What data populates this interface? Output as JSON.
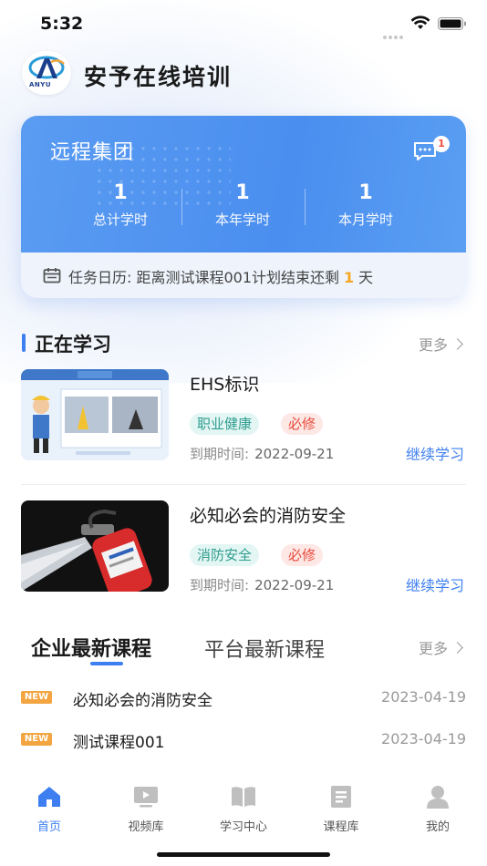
{
  "status_bar": {
    "time": "5:32"
  },
  "header": {
    "logo_text": "ANYU",
    "app_title": "安予在线培训"
  },
  "stats_card": {
    "company": "远程集团",
    "message_count": "1",
    "stats": [
      {
        "value": "1",
        "label": "总计学时"
      },
      {
        "value": "1",
        "label": "本年学时"
      },
      {
        "value": "1",
        "label": "本月学时"
      }
    ],
    "task_prefix": "任务日历: 距离测试课程001计划结束还剩",
    "task_days": "1",
    "task_suffix": "天"
  },
  "learning": {
    "title": "正在学习",
    "more": "更多",
    "courses": [
      {
        "title": "EHS标识",
        "category": "职业健康",
        "required": "必修",
        "due_label": "到期时间:",
        "due_date": "2022-09-21",
        "action": "继续学习"
      },
      {
        "title": "必知必会的消防安全",
        "category": "消防安全",
        "required": "必修",
        "due_label": "到期时间:",
        "due_date": "2022-09-21",
        "action": "继续学习"
      }
    ]
  },
  "latest": {
    "tab_active": "企业最新课程",
    "tab_inactive": "平台最新课程",
    "more": "更多",
    "items": [
      {
        "badge": "NEW",
        "title": "必知必会的消防安全",
        "date": "2023-04-19"
      },
      {
        "badge": "NEW",
        "title": "测试课程001",
        "date": "2023-04-19"
      }
    ]
  },
  "tab_bar": {
    "items": [
      {
        "label": "首页",
        "icon": "home-icon"
      },
      {
        "label": "视频库",
        "icon": "video-icon"
      },
      {
        "label": "学习中心",
        "icon": "book-icon"
      },
      {
        "label": "课程库",
        "icon": "course-icon"
      },
      {
        "label": "我的",
        "icon": "user-icon"
      }
    ]
  },
  "colors": {
    "accent": "#3d7ff0",
    "card_blue": "#4a8eef",
    "new_badge": "#f2a540",
    "required": "#e84a3a",
    "category": "#2f9d8e"
  }
}
